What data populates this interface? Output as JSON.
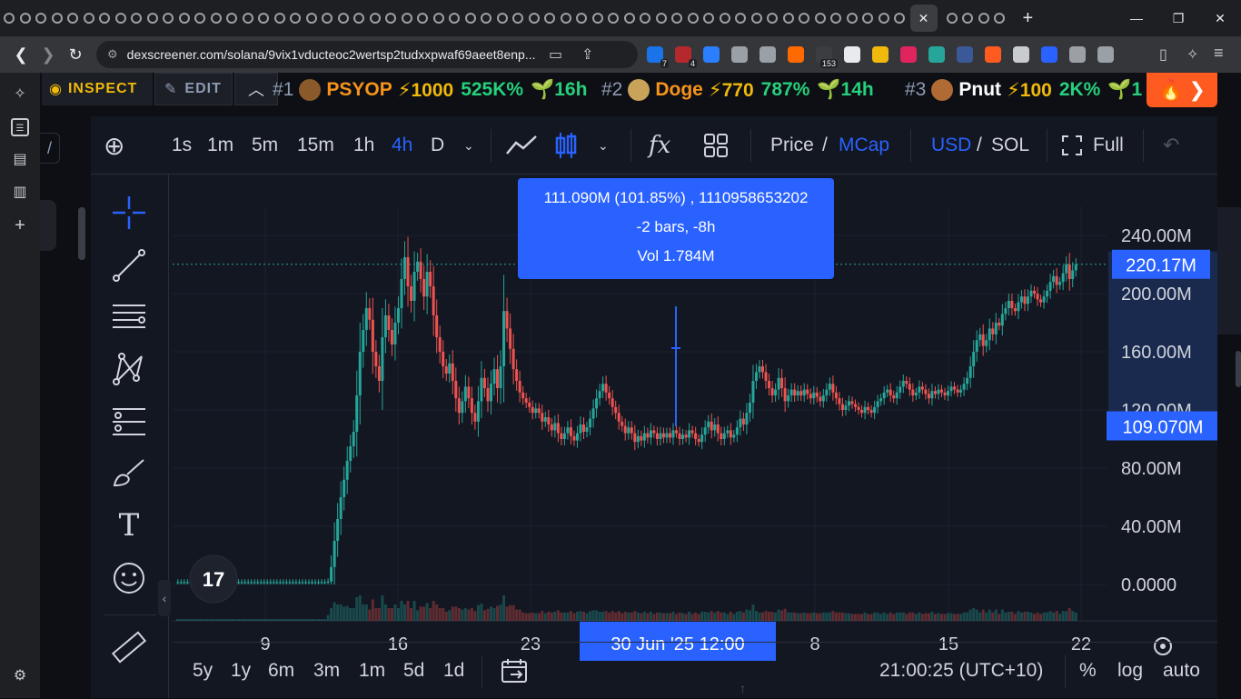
{
  "browser": {
    "url": "dexscreener.com/solana/9vix1vducteoc2wertsp2tudxxpwaf69aeet8enp...",
    "active_tab_close": "✕",
    "new_tab": "+",
    "window_controls": [
      "—",
      "❐",
      "✕"
    ],
    "tab_count": 61,
    "extension_badges": [
      "7",
      "4",
      "153"
    ]
  },
  "ticker": {
    "inspect_label": "INSPECT",
    "edit_label": "EDIT",
    "trending": [
      {
        "rank": "#1",
        "name": "PSYOP",
        "boost": "⚡1000",
        "change": "525K%",
        "age": "🌱16h",
        "color": "#f7931a"
      },
      {
        "rank": "#2",
        "name": "Doge",
        "boost": "⚡770",
        "change": "787%",
        "age": "🌱14h",
        "color": "#f7931a"
      },
      {
        "rank": "#3",
        "name": "Pnut",
        "boost": "⚡100",
        "change": "2K%",
        "age": "🌱1",
        "color": "#ffffff"
      }
    ]
  },
  "toolbar": {
    "intervals": [
      "1s",
      "1m",
      "5m",
      "15m",
      "1h",
      "4h",
      "D"
    ],
    "active_interval": "4h",
    "price_label": "Price",
    "mcap_label": "MCap",
    "usd_label": "USD",
    "sol_label": "SOL",
    "full_label": "Full",
    "slash": "/"
  },
  "tooltip": {
    "line1": "111.090M (101.85%) , 1110958653202",
    "line2": "-2 bars, -8h",
    "line3": "Vol 1.784M"
  },
  "chart_data": {
    "type": "candlestick",
    "y_axis": {
      "ticks": [
        "240.00M",
        "200.00M",
        "160.00M",
        "120.00M",
        "80.00M",
        "40.00M",
        "0.0000"
      ],
      "values": [
        240,
        200,
        160,
        120,
        80,
        40,
        0
      ],
      "unit": "M"
    },
    "x_axis": {
      "ticks": [
        "9",
        "16",
        "23",
        "8",
        "15",
        "22"
      ]
    },
    "crosshair_x_label": "30 Jun '25   12:00",
    "last_price_label": "220.17M",
    "last_price": 220.17,
    "crosshair_price_label": "109.070M",
    "crosshair_price": 109.07,
    "up_color": "#26a69a",
    "down_color": "#ef5350",
    "series_close": [
      1.6,
      1.6,
      1.6,
      1.6,
      1.6,
      1.6,
      1.6,
      1.6,
      1.6,
      1.6,
      1.6,
      1.6,
      1.6,
      1.6,
      1.6,
      1.6,
      1.6,
      1.6,
      1.6,
      1.6,
      1.6,
      1.6,
      1.6,
      1.6,
      1.6,
      1.6,
      1.6,
      1.6,
      1.6,
      1.6,
      1.6,
      1.6,
      1.6,
      1.6,
      1.6,
      1.6,
      1.6,
      1.6,
      1.6,
      1.6,
      1.6,
      1.6,
      1.6,
      1.6,
      1.6,
      1.6,
      1.6,
      2,
      12,
      30,
      45,
      60,
      72,
      85,
      95,
      105,
      130,
      160,
      175,
      190,
      182,
      160,
      150,
      140,
      170,
      185,
      175,
      165,
      180,
      190,
      210,
      225,
      205,
      195,
      215,
      222,
      210,
      198,
      215,
      205,
      185,
      170,
      160,
      150,
      145,
      152,
      140,
      128,
      118,
      126,
      136,
      128,
      118,
      112,
      126,
      142,
      135,
      126,
      138,
      148,
      135,
      150,
      188,
      176,
      162,
      148,
      140,
      132,
      128,
      125,
      122,
      118,
      121,
      118,
      112,
      115,
      110,
      106,
      111,
      104,
      100,
      104,
      108,
      102,
      99,
      104,
      110,
      105,
      108,
      114,
      121,
      128,
      133,
      138,
      132,
      128,
      122,
      118,
      112,
      109,
      104,
      108,
      104,
      98,
      102,
      99,
      104,
      101,
      106,
      104,
      100,
      104,
      101,
      104,
      101,
      106,
      104,
      100,
      103,
      101,
      106,
      104,
      100,
      98,
      103,
      108,
      112,
      106,
      110,
      104,
      100,
      104,
      106,
      101,
      103,
      108,
      114,
      110,
      118,
      125,
      140,
      146,
      150,
      146,
      140,
      135,
      130,
      134,
      142,
      135,
      126,
      130,
      134,
      130,
      133,
      130,
      134,
      131,
      128,
      132,
      129,
      126,
      130,
      134,
      138,
      132,
      128,
      124,
      120,
      123,
      126,
      124,
      122,
      120,
      118,
      122,
      120,
      118,
      122,
      126,
      128,
      132,
      134,
      130,
      128,
      132,
      136,
      140,
      138,
      134,
      130,
      132,
      136,
      134,
      131,
      128,
      133,
      131,
      134,
      132,
      130,
      133,
      136,
      134,
      132,
      134,
      138,
      142,
      150,
      160,
      168,
      172,
      164,
      168,
      176,
      172,
      180,
      178,
      186,
      190,
      195,
      190,
      188,
      194,
      198,
      193,
      198,
      202,
      200,
      196,
      194,
      198,
      202,
      208,
      212,
      206,
      208,
      214,
      220,
      210,
      216,
      220
    ]
  },
  "bottombar": {
    "ranges": [
      "5y",
      "1y",
      "6m",
      "3m",
      "1m",
      "5d",
      "1d"
    ],
    "time": "21:00:25 (UTC+10)",
    "percent_label": "%",
    "log_label": "log",
    "auto_label": "auto"
  }
}
